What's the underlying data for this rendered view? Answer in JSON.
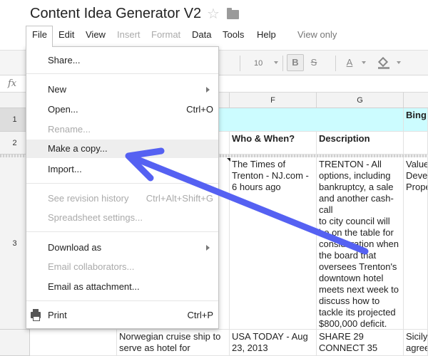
{
  "document": {
    "title": "Content Idea Generator V2"
  },
  "menu_bar": [
    {
      "label": "File",
      "disabled": false
    },
    {
      "label": "Edit",
      "disabled": false
    },
    {
      "label": "View",
      "disabled": false
    },
    {
      "label": "Insert",
      "disabled": true
    },
    {
      "label": "Format",
      "disabled": true
    },
    {
      "label": "Data",
      "disabled": false
    },
    {
      "label": "Tools",
      "disabled": false
    },
    {
      "label": "Help",
      "disabled": false
    }
  ],
  "view_only_label": "View only",
  "toolbar": {
    "font_size": "10",
    "bold_label": "B",
    "strike_label": "S",
    "text_color_label": "A"
  },
  "file_menu": {
    "share": {
      "label": "Share..."
    },
    "new": {
      "label": "New"
    },
    "open": {
      "label": "Open...",
      "shortcut": "Ctrl+O"
    },
    "rename": {
      "label": "Rename..."
    },
    "make_copy": {
      "label": "Make a copy..."
    },
    "import": {
      "label": "Import..."
    },
    "revision_history": {
      "label": "See revision history",
      "shortcut": "Ctrl+Alt+Shift+G"
    },
    "spreadsheet_settings": {
      "label": "Spreadsheet settings..."
    },
    "download_as": {
      "label": "Download as"
    },
    "email_collaborators": {
      "label": "Email collaborators..."
    },
    "email_attachment": {
      "label": "Email as attachment..."
    },
    "print": {
      "label": "Print",
      "shortcut": "Ctrl+P"
    }
  },
  "sheet": {
    "columns": [
      {
        "label": "F"
      },
      {
        "label": "G"
      }
    ],
    "rows": [
      {
        "label": "1"
      },
      {
        "label": "2"
      },
      {
        "label": "3"
      }
    ],
    "cells": {
      "h1": "Bing",
      "f2": "Who & When?",
      "g2": "Description",
      "f3": "The Times of Trenton - NJ.com - 6 hours ago",
      "g3": "TRENTON - All options, including bankruptcy, a sale and another cash-call\nto city council will be on the table for consideration when the board that oversees Trenton's downtown hotel meets next week to discuss how to tackle its projected $800,000 deficit.",
      "h3": "Value\nDevel\nPrope",
      "e4": "Norwegian cruise ship to serve as hotel for",
      "f4": "USA TODAY - Aug 23, 2013",
      "g4": "SHARE 29 CONNECT 35",
      "h4": "Sicily\nagree"
    }
  },
  "colors": {
    "header_cyan": "#ccfcff",
    "annotation_arrow": "#5561f2"
  }
}
